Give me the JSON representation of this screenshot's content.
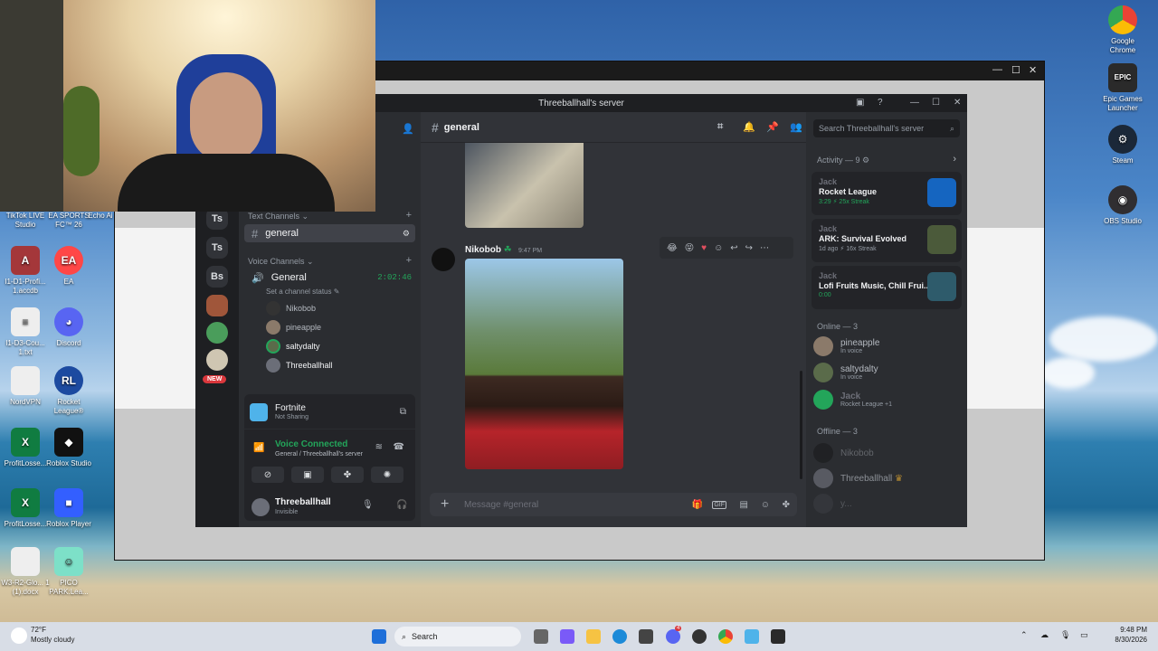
{
  "desktop": {
    "right_icons": [
      {
        "label": "Google Chrome",
        "icon": "chrome-icon",
        "color": "#e8453c"
      },
      {
        "label": "Epic Games Launcher",
        "icon": "epic-games-icon",
        "color": "#2a2a2a"
      },
      {
        "label": "Steam",
        "icon": "steam-icon",
        "color": "#1b2838"
      },
      {
        "label": "OBS Studio",
        "icon": "obs-icon",
        "color": "#302e31"
      }
    ],
    "left_icons": [
      {
        "label": "TikTok LIVE Studio",
        "color": "#111111"
      },
      {
        "label": "EA SPORTS FC™ 26",
        "color": "#1a1a1a"
      },
      {
        "label": "Echo Ai",
        "color": "#333333"
      },
      {
        "label": "I1-D1-Profi... 1.accdb",
        "color": "#a4373a"
      },
      {
        "label": "EA",
        "color": "#ff4747"
      },
      {
        "label": "I1-D3-Cou... 1.txt",
        "color": "#eeeeee"
      },
      {
        "label": "Discord",
        "color": "#5865f2"
      },
      {
        "label": "NordVPN",
        "color": "#eeeeee"
      },
      {
        "label": "Rocket League®",
        "color": "#1c4aa0"
      },
      {
        "label": "ProfitLosse...",
        "color": "#107c41"
      },
      {
        "label": "Roblox Studio",
        "color": "#111111"
      },
      {
        "label": "ProfitLosse...",
        "color": "#107c41"
      },
      {
        "label": "Roblox Player",
        "color": "#335fff"
      },
      {
        "label": "W3-R2-Glo... 1 (1).docx",
        "color": "#eeeeee"
      },
      {
        "label": "PICO PARK:Lea...",
        "color": "#7de0c8"
      }
    ]
  },
  "discord": {
    "window_title": "Threeballhall's server",
    "servers": [
      "Ts",
      "Ts",
      "Bs"
    ],
    "new_badge": "NEW",
    "text_channels_label": "Text Channels",
    "active_channel": "general",
    "voice_channels_label": "Voice Channels",
    "voice_channel": "General",
    "voice_timer": "2:02:46",
    "set_status": "Set a channel status",
    "voice_users": [
      "Nikobob",
      "pineapple",
      "saltydalty",
      "Threeballhall"
    ],
    "activity_panel": {
      "game": "Fortnite",
      "status": "Not Sharing"
    },
    "voice_connected": {
      "title": "Voice Connected",
      "location": "General / Threeballhall's server"
    },
    "user": {
      "name": "Threeballhall",
      "status": "Invisible"
    },
    "chat": {
      "channel": "general",
      "author": "Nikobob",
      "time": "9:47 PM",
      "message_placeholder": "Message #general"
    },
    "members": {
      "search_placeholder": "Search Threeballhall's server",
      "activity_header": "Activity — 9",
      "activities": [
        {
          "user": "Jack",
          "game": "Rocket League",
          "meta": "3:29  ⚡ 25x Streak",
          "thumb": "#1565c0"
        },
        {
          "user": "Jack",
          "game": "ARK: Survival Evolved",
          "meta": "1d ago  ⚡ 16x Streak",
          "thumb": "#4b5a3a"
        },
        {
          "user": "Jack",
          "game": "Lofi Fruits Music, Chill Frui...",
          "meta": "0:00",
          "thumb": "#2e5b6b"
        }
      ],
      "online_header": "Online — 3",
      "online": [
        {
          "name": "pineapple",
          "status": "In voice"
        },
        {
          "name": "saltydalty",
          "status": "In voice"
        },
        {
          "name": "Jack",
          "status": "Rocket League +1"
        }
      ],
      "offline_header": "Offline — 3",
      "offline": [
        "Nikobob",
        "Threeballhall",
        "y..."
      ]
    }
  },
  "taskbar": {
    "weather_temp": "72°F",
    "weather_desc": "Mostly cloudy",
    "search_label": "Search",
    "time": "9:48 PM",
    "date": "8/30/2026",
    "discord_badge": "4"
  }
}
